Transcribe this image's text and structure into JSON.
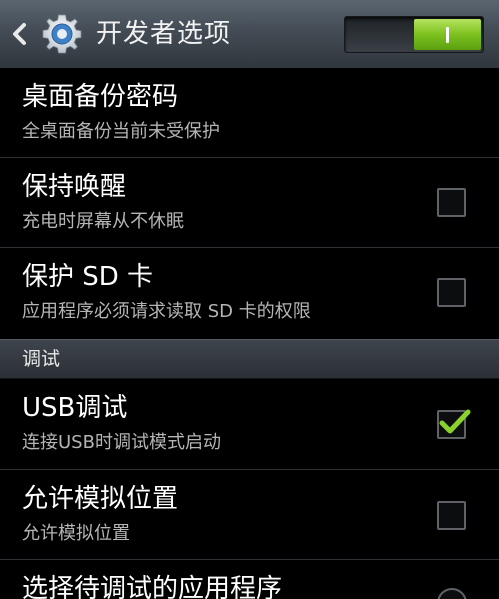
{
  "action_bar": {
    "title": "开发者选项",
    "back_icon": "chevron-left-icon",
    "settings_icon": "gear-icon",
    "master_switch": {
      "state": "on",
      "label": "I",
      "accent": "#7dc11f"
    }
  },
  "items": [
    {
      "title": "桌面备份密码",
      "subtitle": "全桌面备份当前未受保护",
      "has_checkbox": false
    },
    {
      "title": "保持唤醒",
      "subtitle": "充电时屏幕从不休眠",
      "has_checkbox": true,
      "checked": false
    },
    {
      "title": "保护 SD 卡",
      "subtitle": "应用程序必须请求读取 SD 卡的权限",
      "has_checkbox": true,
      "checked": false
    }
  ],
  "section": {
    "label": "调试"
  },
  "debug_items": [
    {
      "title": "USB调试",
      "subtitle": "连接USB时调试模式启动",
      "has_checkbox": true,
      "checked": true
    },
    {
      "title": "允许模拟位置",
      "subtitle": "允许模拟位置",
      "has_checkbox": true,
      "checked": false
    },
    {
      "title": "选择待调试的应用程序",
      "subtitle": "",
      "has_checkbox": false
    }
  ],
  "colors": {
    "check_mark": "#8ad12b",
    "background": "#000000",
    "divider": "#2e3135"
  }
}
